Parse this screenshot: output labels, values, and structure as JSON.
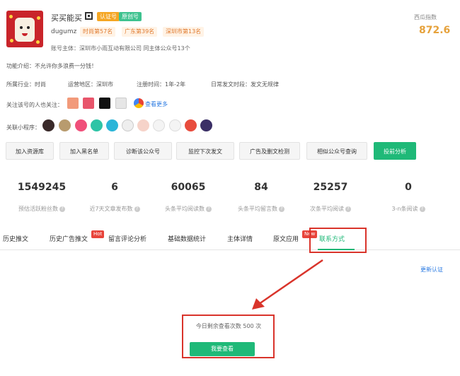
{
  "header": {
    "account_name": "买买能买",
    "badges": [
      "认证号",
      "原创号"
    ],
    "account_id": "dugumz",
    "ranks": [
      "时尚第57名",
      "广东第39名",
      "深圳市第13名"
    ],
    "entity": "账号主体：深圳市小雨互动有限公司 同主体公众号13个",
    "index_label": "西瓜指数",
    "index_value": "872.6"
  },
  "intro": "功能介绍：不允许你多浪费一分钱！",
  "meta": {
    "industry": "所属行业：时尚",
    "region": "运营地区：深圳市",
    "registered": "注册时间：1年-2年",
    "post_time": "日常发文时段：发文无规律"
  },
  "fans_also_follow": {
    "label": "关注该号的人也关注：",
    "see_more": "查看更多"
  },
  "mini_programs": {
    "label": "关联小程序："
  },
  "actions": [
    "加入资源库",
    "加入黑名单",
    "诊断该公众号",
    "监控下次发文",
    "广告及删文检测",
    "相似公众号查询",
    "投前分析"
  ],
  "stats": [
    {
      "value": "1549245",
      "label": "预估活跃粉丝数"
    },
    {
      "value": "6",
      "label": "近7天文章发布数"
    },
    {
      "value": "60065",
      "label": "头条平均阅读数"
    },
    {
      "value": "84",
      "label": "头条平均留言数"
    },
    {
      "value": "25257",
      "label": "次条平均阅读"
    },
    {
      "value": "0",
      "label": "3-n条阅读"
    }
  ],
  "tabs": [
    {
      "label": "历史推文"
    },
    {
      "label": "历史广告推文",
      "tag": "Hot"
    },
    {
      "label": "留言评论分析"
    },
    {
      "label": "基础数据统计"
    },
    {
      "label": "主体详情"
    },
    {
      "label": "原文应用",
      "tag": "New"
    },
    {
      "label": "联系方式"
    }
  ],
  "update_link": "更新认证",
  "contact": {
    "remaining": "今日剩余查看次数 500 次",
    "button": "我要查看"
  },
  "colors": {
    "accent": "#1fb978",
    "highlight_box": "#d9342b",
    "index": "#e6a23c"
  }
}
